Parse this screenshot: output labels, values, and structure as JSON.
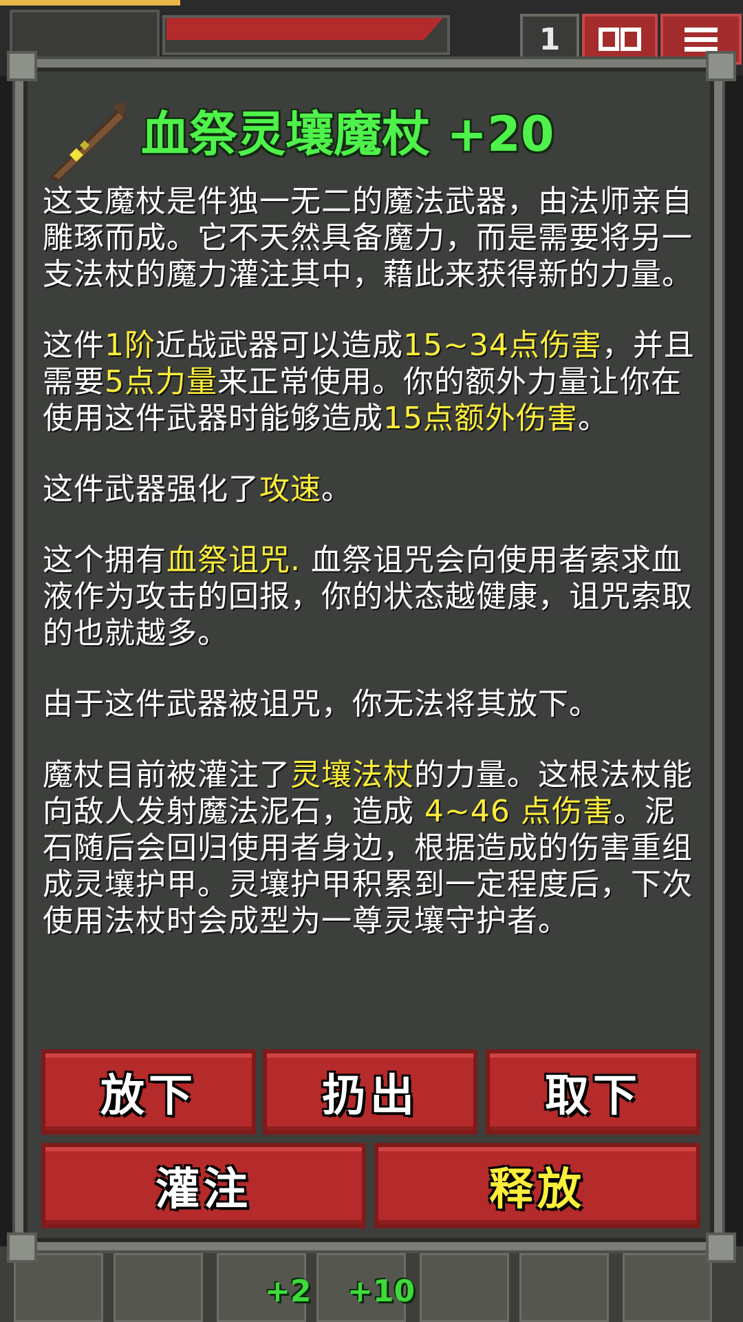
{
  "hud": {
    "depth": "1",
    "journal_icon": "journal-icon",
    "menu_icon": "menu-icon",
    "quickslots": [
      {
        "label": "",
        "icon": "cloth-armor-icon"
      },
      {
        "label": "",
        "icon": "staff-icon"
      },
      {
        "label": "+2",
        "icon": "sword-icon"
      },
      {
        "label": "+10",
        "icon": "armor-icon"
      },
      {
        "label": "",
        "icon": "wand-icon"
      },
      {
        "label": "",
        "icon": "dagger-icon"
      },
      {
        "label": "",
        "icon": "backpack-icon"
      }
    ],
    "colors": {
      "hp": "#b42b2b",
      "xp": "#e8b84a"
    }
  },
  "item": {
    "title": "血祭灵壤魔杖 +20",
    "icon": "magic-staff-icon",
    "title_color": "#4ef24a"
  },
  "description": {
    "p1": "这支魔杖是件独一无二的魔法武器，由法师亲自雕琢而成。它不天然具备魔力，而是需要将另一支法杖的魔力灌注其中，藉此来获得新的力量。",
    "p2": [
      {
        "text": "这件",
        "hl": false
      },
      {
        "text": "1阶",
        "hl": true
      },
      {
        "text": "近战武器可以造成",
        "hl": false
      },
      {
        "text": "15~34点伤害",
        "hl": true
      },
      {
        "text": "，并且需要",
        "hl": false
      },
      {
        "text": "5点力量",
        "hl": true
      },
      {
        "text": "来正常使用。你的额外力量让你在使用这件武器时能够造成",
        "hl": false
      },
      {
        "text": "15点额外伤害",
        "hl": true
      },
      {
        "text": "。",
        "hl": false
      }
    ],
    "p3": [
      {
        "text": "这件武器强化了",
        "hl": false
      },
      {
        "text": "攻速",
        "hl": true
      },
      {
        "text": "。",
        "hl": false
      }
    ],
    "p4": [
      {
        "text": "这个拥有",
        "hl": false
      },
      {
        "text": "血祭诅咒.",
        "hl": true
      },
      {
        "text": " 血祭诅咒会向使用者索求血液作为攻击的回报，你的状态越健康，诅咒索取的也就越多。",
        "hl": false
      }
    ],
    "p5": "由于这件武器被诅咒，你无法将其放下。",
    "p6": [
      {
        "text": "魔杖目前被灌注了",
        "hl": false
      },
      {
        "text": "灵壤法杖",
        "hl": true
      },
      {
        "text": "的力量。这根法杖能向敌人发射魔法泥石，造成 ",
        "hl": false
      },
      {
        "text": "4~46 点伤害",
        "hl": true
      },
      {
        "text": "。泥石随后会回归使用者身边，根据造成的伤害重组成灵壤护甲。灵壤护甲积累到一定程度后，下次使用法杖时会成型为一尊灵壤守护者。",
        "hl": false
      }
    ],
    "highlight_color": "#fdee3a"
  },
  "buttons": {
    "drop": "放下",
    "throw": "扔出",
    "unequip": "取下",
    "imbue": "灌注",
    "release": "释放"
  }
}
